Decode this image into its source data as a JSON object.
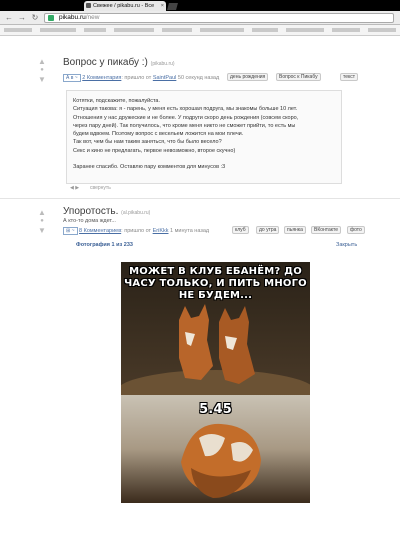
{
  "browser": {
    "tab_title": "Свежее / pikabu.ru - Все",
    "url_host": "pikabu.ru",
    "url_path": "/new"
  },
  "posts": [
    {
      "title": "Вопрос у пикабу :)",
      "source": "(pikabu.ru)",
      "badge": "А в ~",
      "comments": "2 Комментария",
      "posted_by": ": пришло от",
      "author": "SaintPaul",
      "time": "50 секунд назад",
      "tags": [
        "день рождения",
        "Вопрос к Пикабу",
        "текст"
      ],
      "body": [
        "Котятки, подскажите, пожалуйста.",
        "Ситуация такова: я - парень, у меня есть хорошая подруга, мы знакомы больше 10 лет.",
        "Отношения у нас дружеские и не более. У подруги скоро день рождения (совсем скоро,",
        "через пару дней). Так получилось, что кроме меня никто не сможет прийти, то есть мы",
        "будем вдвоем. Поэтому вопрос с весельем ложится на мои плечи.",
        "Так вот, чем бы нам таким заняться, что бы было весело?",
        "Секс и кино не предлагать, первое невозможно, второе скучно)",
        "",
        "Заранее спасибо. Оставлю пару комментов для минусов :3"
      ],
      "collapse": "свернуть"
    },
    {
      "title": "Упоротость.",
      "source": "(al.pikabu.ru)",
      "subtitle": "А кто-то дома ждет...",
      "badge": "⊞ ~",
      "comments": "8 Комментариев",
      "posted_by": ": пришло от",
      "author": "EriKkk",
      "time": "1 минута назад",
      "tags": [
        "клуб",
        "до утра",
        "пьянка",
        "ВКонтакте",
        "фото"
      ]
    }
  ],
  "gallery": {
    "counter": "Фотография 1 из 233",
    "close": "Закрыть"
  },
  "photo": {
    "caption_top": "МОЖЕТ В КЛУБ ЕБАНЁМ? ДО ЧАСУ ТОЛЬКО, И ПИТЬ МНОГО НЕ БУДЕМ...",
    "caption_time": "5.45"
  }
}
